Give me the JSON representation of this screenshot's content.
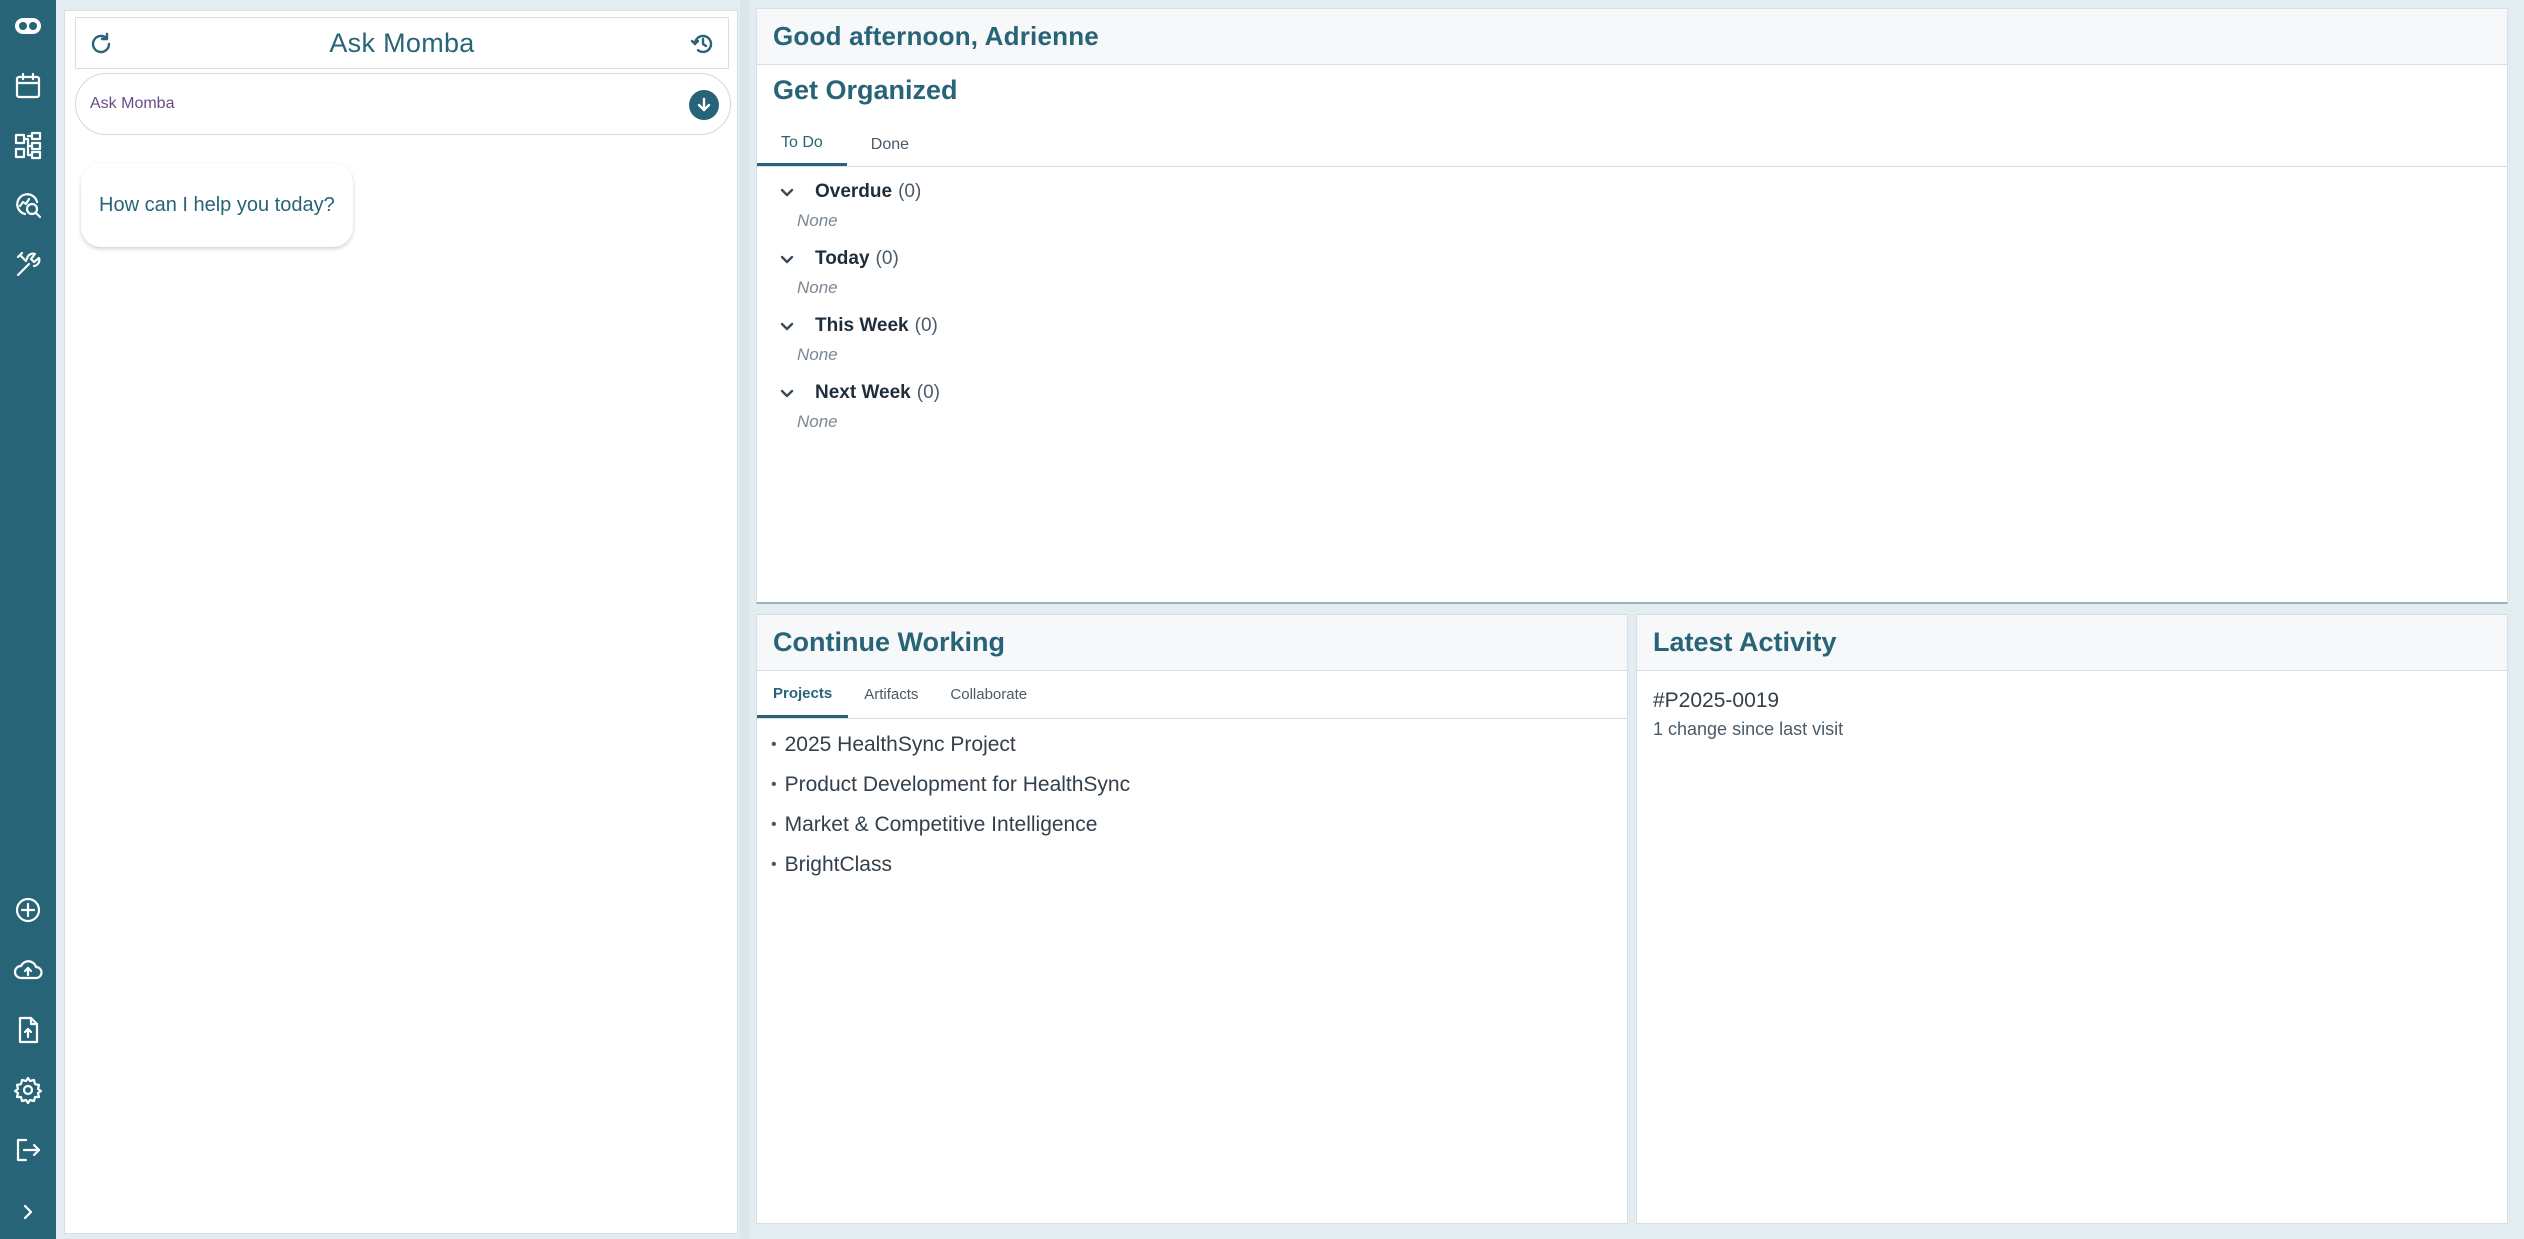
{
  "rail": {
    "top_icons": [
      "logo-icon",
      "calendar-icon",
      "workflow-icon",
      "search-chart-icon",
      "tools-icon"
    ],
    "bottom_icons": [
      "add-circle-icon",
      "cloud-upload-icon",
      "file-upload-icon",
      "settings-gear-icon",
      "logout-icon",
      "expand-chevron-icon"
    ],
    "color": "#276478"
  },
  "chat": {
    "title": "Ask Momba",
    "input_placeholder": "Ask Momba",
    "greeting_bubble": "How can I help you today?"
  },
  "main": {
    "greeting": "Good afternoon, Adrienne",
    "organize": {
      "title": "Get Organized",
      "tabs": [
        {
          "label": "To Do",
          "active": true
        },
        {
          "label": "Done",
          "active": false
        }
      ],
      "groups": [
        {
          "name": "Overdue",
          "count": "(0)",
          "empty_text": "None"
        },
        {
          "name": "Today",
          "count": "(0)",
          "empty_text": "None"
        },
        {
          "name": "This Week",
          "count": "(0)",
          "empty_text": "None"
        },
        {
          "name": "Next Week",
          "count": "(0)",
          "empty_text": "None"
        }
      ]
    },
    "continue_working": {
      "title": "Continue Working",
      "tabs": [
        {
          "label": "Projects",
          "active": true
        },
        {
          "label": "Artifacts",
          "active": false
        },
        {
          "label": "Collaborate",
          "active": false
        }
      ],
      "projects": [
        "2025 HealthSync Project",
        "Product Development for HealthSync",
        "Market & Competitive Intelligence",
        "BrightClass"
      ]
    },
    "latest_activity": {
      "title": "Latest Activity",
      "item_id": "#P2025-0019",
      "item_change": "1 change since last visit"
    }
  },
  "colors": {
    "accent": "#276478",
    "background": "#e3ecf1"
  }
}
